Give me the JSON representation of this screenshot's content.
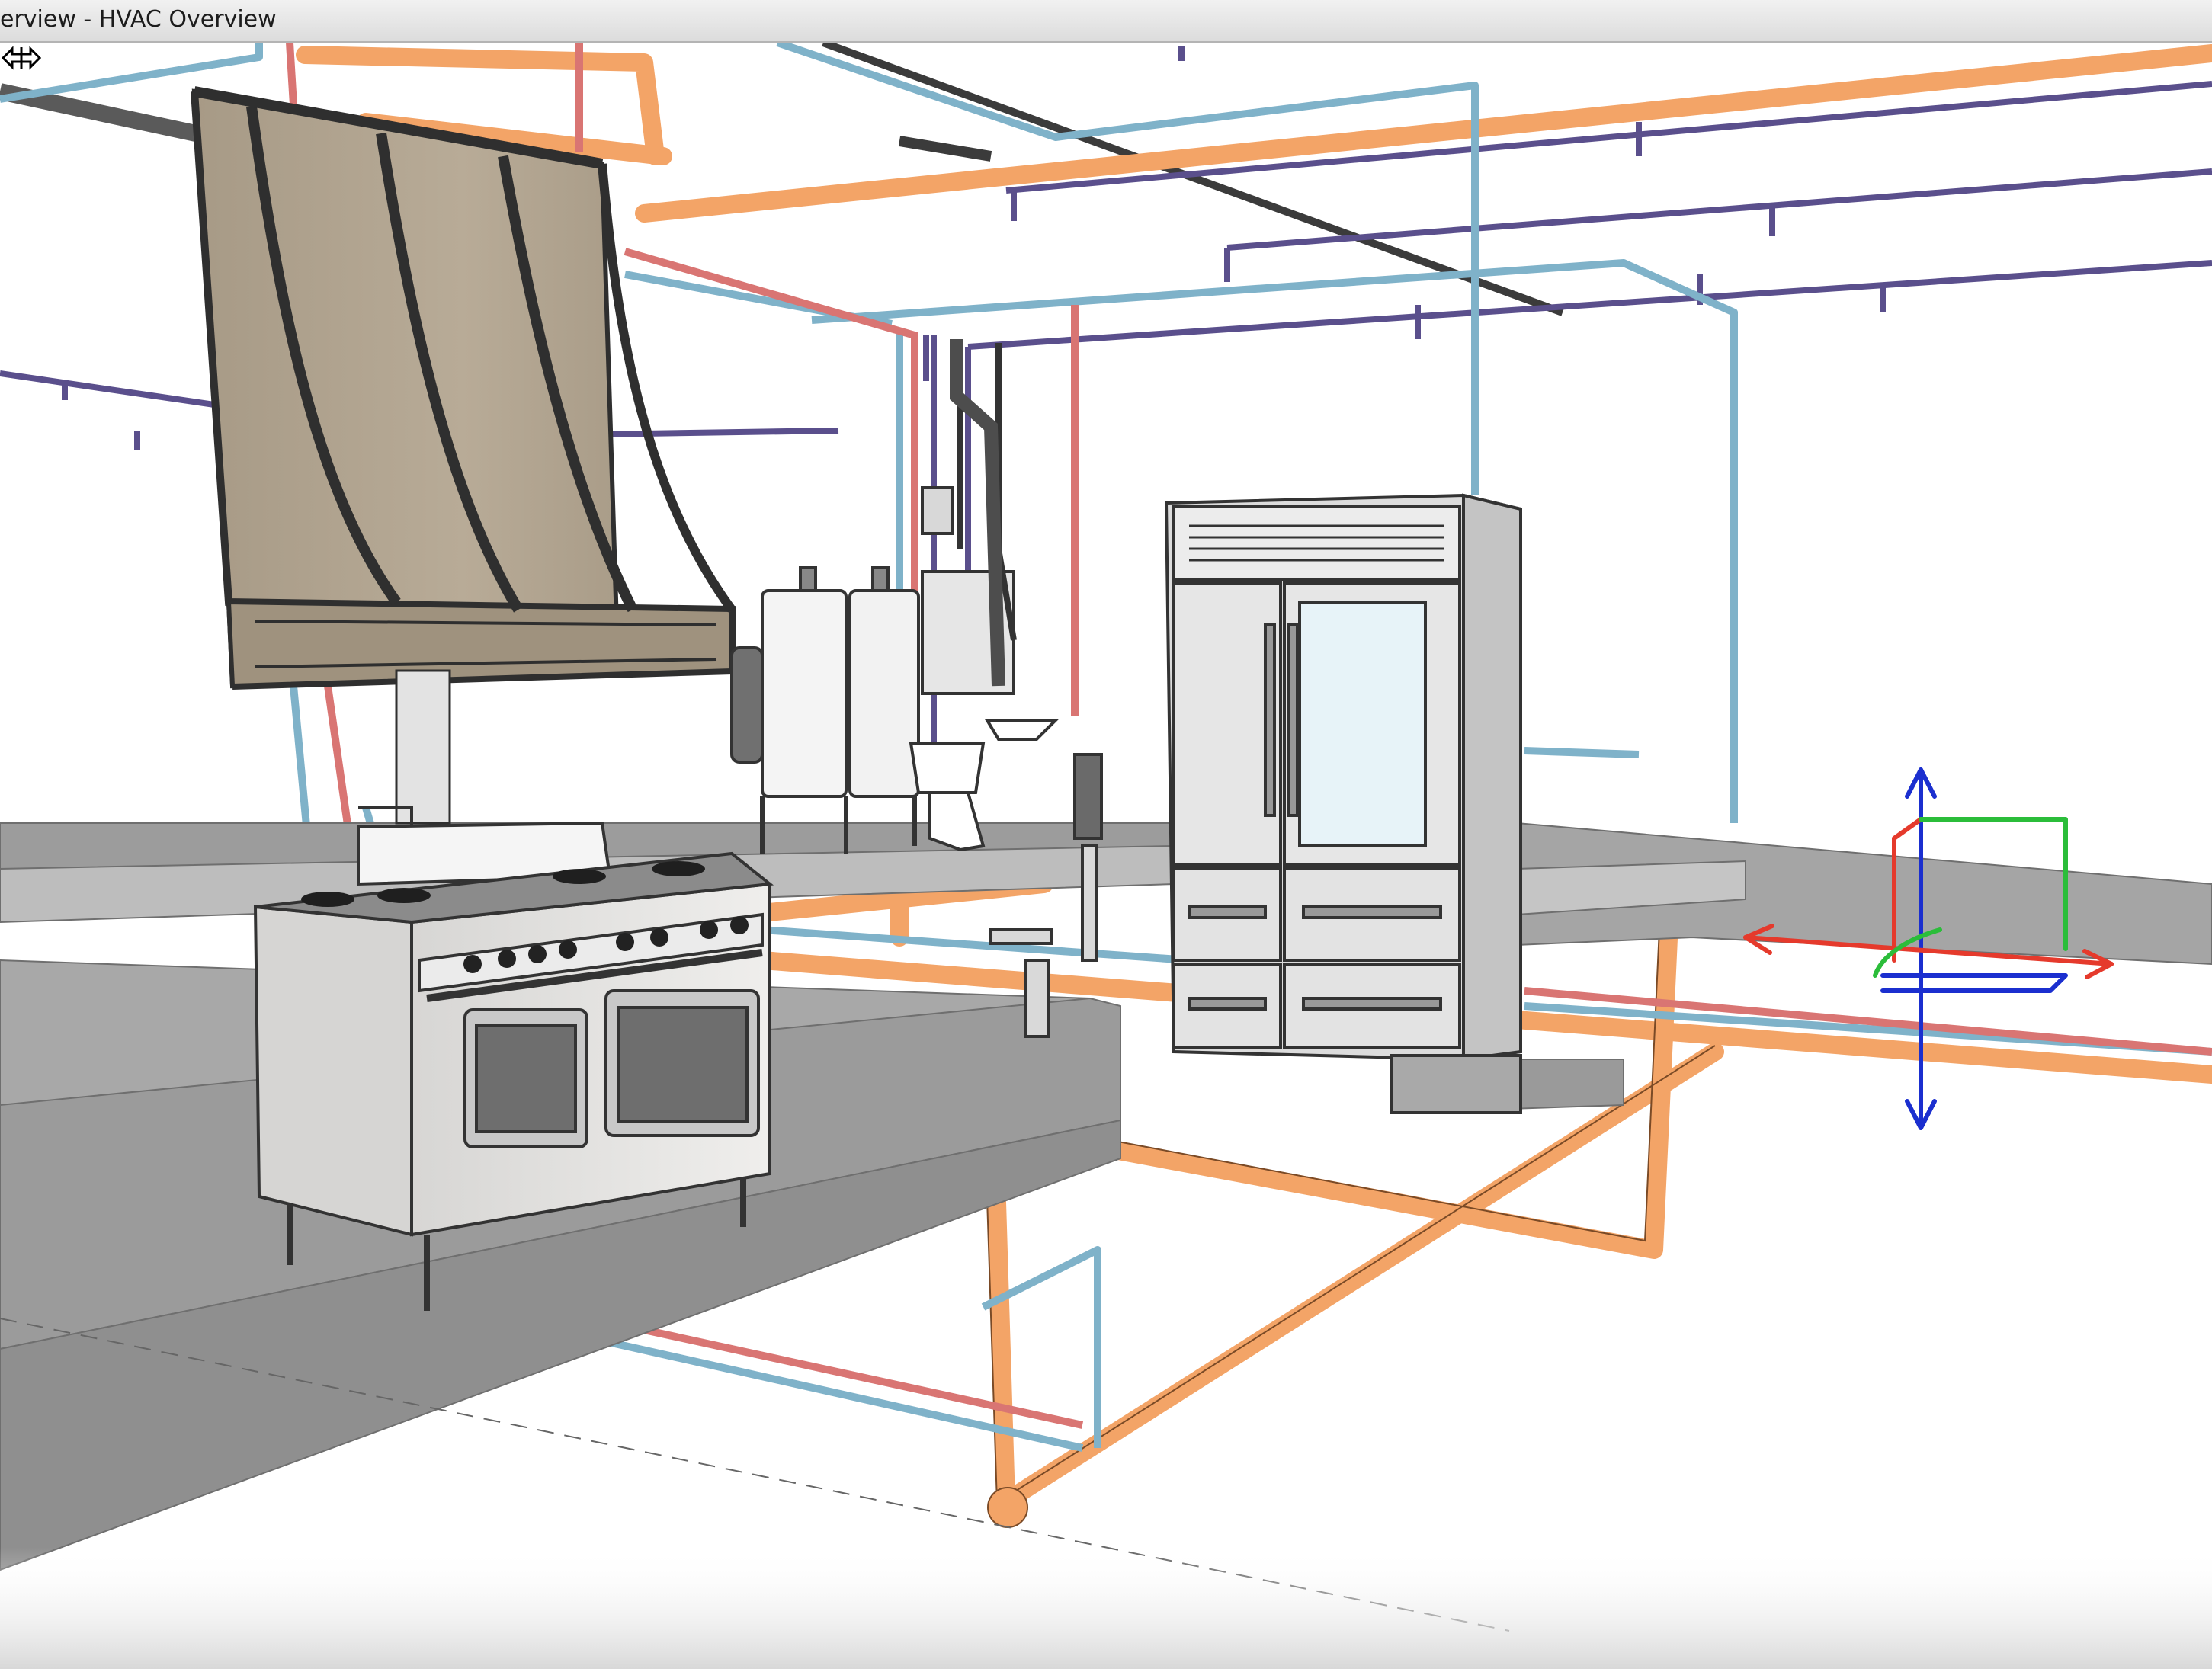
{
  "window": {
    "title": "erview - HVAC Overview"
  },
  "viewport": {
    "view_name": "HVAC Overview",
    "view_type": "3D"
  },
  "model": {
    "objects": [
      "range-hood",
      "range-stove",
      "refrigerator",
      "water-heater",
      "toilet",
      "sink",
      "floor-drain-valve",
      "kitchen-counter"
    ],
    "systems": [
      {
        "name": "gas-line",
        "color": "#f3a467"
      },
      {
        "name": "cold-water",
        "color": "#7fb2c9"
      },
      {
        "name": "hot-water",
        "color": "#d97573"
      },
      {
        "name": "sanitary",
        "color": "#5a4f8c"
      },
      {
        "name": "duct-hangers",
        "color": "#3b3b3b"
      }
    ]
  },
  "gizmo": {
    "axes": [
      {
        "name": "x-axis",
        "color": "#e53a2c"
      },
      {
        "name": "y-axis",
        "color": "#2bbd3a"
      },
      {
        "name": "z-axis",
        "color": "#1b2fcf"
      }
    ]
  },
  "cursor": {
    "icon": "move-horizontal-cursor-icon"
  }
}
